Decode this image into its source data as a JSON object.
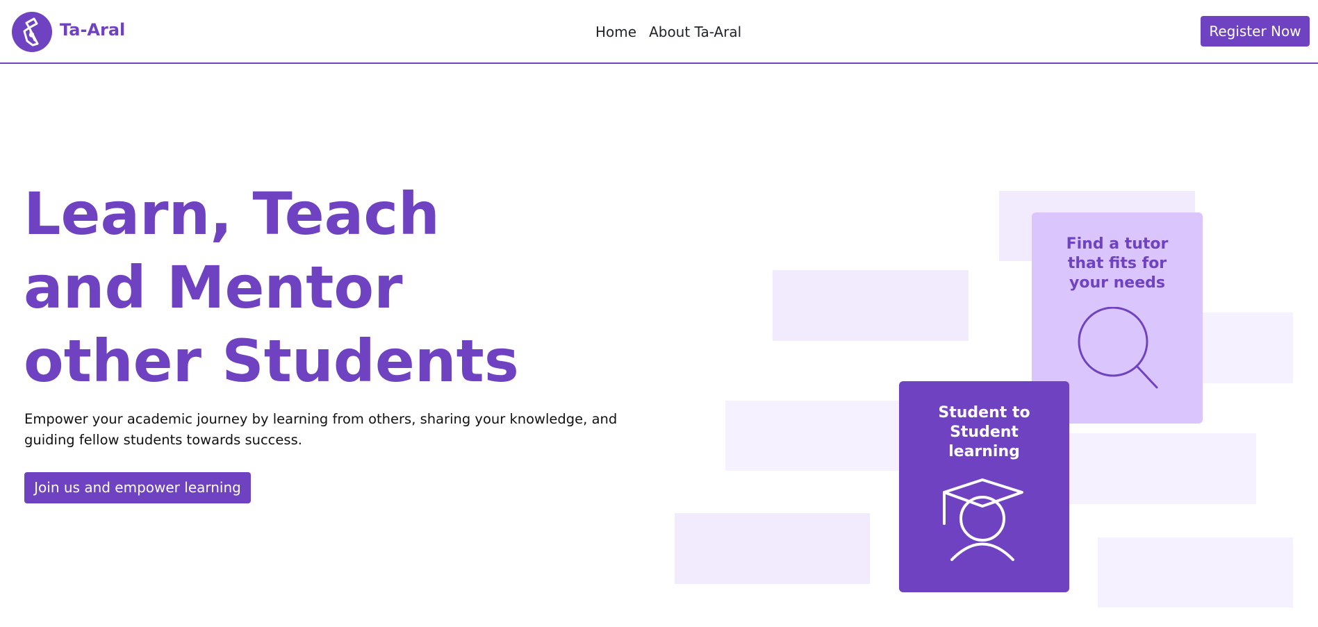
{
  "brand": {
    "name": "Ta-Aral",
    "logo_icon": "pen-nib-icon"
  },
  "nav": {
    "links": [
      "Home",
      "About Ta-Aral"
    ],
    "register_label": "Register Now"
  },
  "hero": {
    "title": "Learn, Teach and Mentor other Students",
    "subtitle": "Empower your academic journey by learning from others, sharing your knowledge, and guiding fellow students towards success.",
    "cta_label": "Join us and empower learning"
  },
  "cards": {
    "tutor": {
      "title": "Find a tutor that fits for your needs",
      "icon": "magnifier-icon"
    },
    "student": {
      "title": "Student to Student learning",
      "icon": "graduate-icon"
    }
  },
  "colors": {
    "accent": "#6f42c1",
    "accent_light": "#dac5fc",
    "deco": "#f2ebfe"
  }
}
